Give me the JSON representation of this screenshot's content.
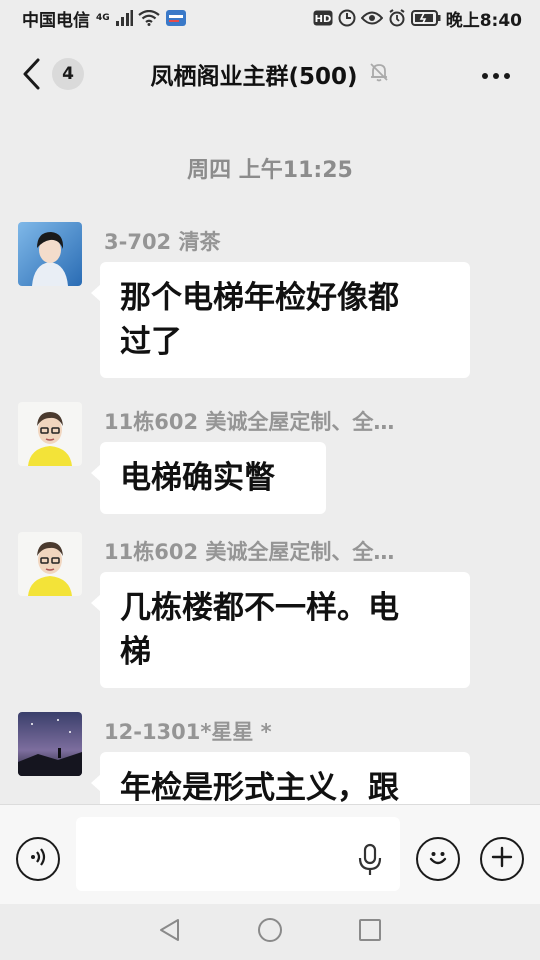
{
  "status_bar": {
    "carrier": "中国电信",
    "network": "4G",
    "time": "晚上8:40",
    "hd": "HD"
  },
  "header": {
    "unread_count": "4",
    "title": "凤栖阁业主群(500)"
  },
  "chat": {
    "time_divider": "周四 上午11:25",
    "messages": [
      {
        "sender": "3-702 清茶",
        "text": "那个电梯年检好像都过了"
      },
      {
        "sender": "11栋602 美诚全屋定制、全…",
        "text": "电梯确实瞥"
      },
      {
        "sender": "11栋602 美诚全屋定制、全…",
        "text": "几栋楼都不一样。电梯"
      },
      {
        "sender": "12-1301*星星 *",
        "text": "年检是形式主义，跟"
      }
    ],
    "message_lines": {
      "m0": [
        "那个电梯年检好像都",
        "过了"
      ],
      "m2": [
        "几栋楼都不一样。电",
        "梯"
      ]
    }
  },
  "input": {
    "value": "",
    "placeholder": ""
  },
  "colors": {
    "background": "#ededed",
    "bubble": "#ffffff",
    "sender": "#959595",
    "badge": "#dadada"
  },
  "icons": [
    "back-icon",
    "mute-bell-icon",
    "more-icon",
    "voice-icon",
    "mic-icon",
    "emoji-icon",
    "plus-icon",
    "nav-back-icon",
    "nav-home-icon",
    "nav-recents-icon"
  ]
}
